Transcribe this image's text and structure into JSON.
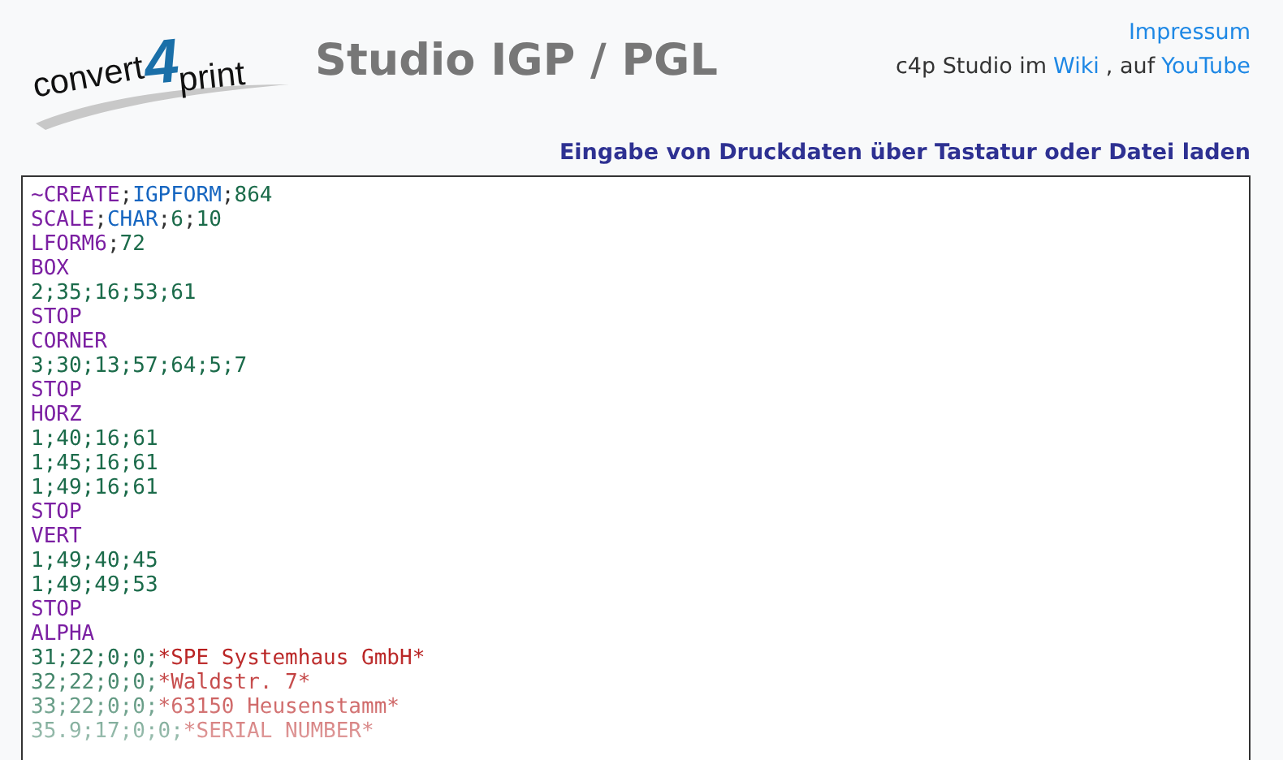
{
  "logo": {
    "parts": [
      {
        "kind": "word",
        "text": "convert"
      },
      {
        "kind": "digit",
        "text": "4"
      },
      {
        "kind": "word",
        "text": "print"
      }
    ]
  },
  "title": "Studio IGP / PGL",
  "links": {
    "impressum": "Impressum",
    "line": [
      {
        "kind": "text",
        "text": "c4p Studio im"
      },
      {
        "kind": "link",
        "text": "Wiki"
      },
      {
        "kind": "text",
        "text": ", auf"
      },
      {
        "kind": "link",
        "text": "YouTube"
      }
    ]
  },
  "subtitle": "Eingabe von Druckdaten über Tastatur oder Datei laden",
  "editor": {
    "lines": [
      [
        {
          "kind": "kw",
          "text": "~CREATE"
        },
        {
          "kind": "p",
          "text": ";"
        },
        {
          "kind": "type",
          "text": "IGPFORM"
        },
        {
          "kind": "p",
          "text": ";"
        },
        {
          "kind": "num",
          "text": "864"
        }
      ],
      [
        {
          "kind": "kw",
          "text": "SCALE"
        },
        {
          "kind": "p",
          "text": ";"
        },
        {
          "kind": "type",
          "text": "CHAR"
        },
        {
          "kind": "p",
          "text": ";"
        },
        {
          "kind": "num",
          "text": "6"
        },
        {
          "kind": "p",
          "text": ";"
        },
        {
          "kind": "num",
          "text": "10"
        }
      ],
      [
        {
          "kind": "kw",
          "text": "LFORM6"
        },
        {
          "kind": "p",
          "text": ";"
        },
        {
          "kind": "num",
          "text": "72"
        }
      ],
      [
        {
          "kind": "kw",
          "text": "BOX"
        }
      ],
      [
        {
          "kind": "num",
          "text": "2;35;16;53;61"
        }
      ],
      [
        {
          "kind": "kw",
          "text": "STOP"
        }
      ],
      [
        {
          "kind": "kw",
          "text": "CORNER"
        }
      ],
      [
        {
          "kind": "num",
          "text": "3;30;13;57;64;5;7"
        }
      ],
      [
        {
          "kind": "kw",
          "text": "STOP"
        }
      ],
      [
        {
          "kind": "kw",
          "text": "HORZ"
        }
      ],
      [
        {
          "kind": "num",
          "text": "1;40;16;61"
        }
      ],
      [
        {
          "kind": "num",
          "text": "1;45;16;61"
        }
      ],
      [
        {
          "kind": "num",
          "text": "1;49;16;61"
        }
      ],
      [
        {
          "kind": "kw",
          "text": "STOP"
        }
      ],
      [
        {
          "kind": "kw",
          "text": "VERT"
        }
      ],
      [
        {
          "kind": "num",
          "text": "1;49;40;45"
        }
      ],
      [
        {
          "kind": "num",
          "text": "1;49;49;53"
        }
      ],
      [
        {
          "kind": "kw",
          "text": "STOP"
        }
      ],
      [
        {
          "kind": "kw",
          "text": "ALPHA"
        }
      ],
      [
        {
          "kind": "num",
          "text": "31;22;0;0;"
        },
        {
          "kind": "str",
          "text": "*SPE Systemhaus GmbH*"
        }
      ],
      [
        {
          "kind": "num",
          "text": "32;22;0;0;"
        },
        {
          "kind": "str",
          "text": "*Waldstr. 7*"
        }
      ],
      [
        {
          "kind": "num",
          "text": "33;22;0;0;"
        },
        {
          "kind": "str",
          "text": "*63150 Heusenstamm*"
        }
      ],
      [
        {
          "kind": "num",
          "text": "35.9;17;0;0;"
        },
        {
          "kind": "str",
          "text": "*SERIAL NUMBER*"
        }
      ]
    ]
  }
}
